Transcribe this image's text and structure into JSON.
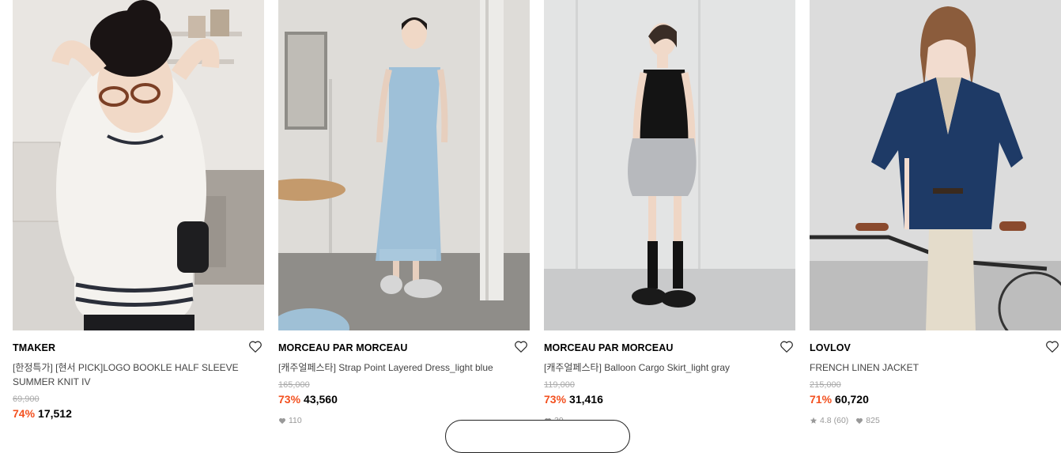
{
  "products": [
    {
      "brand": "TMAKER",
      "title": "[한정특가] [현서 PICK]LOGO BOOKLE HALF SLEEVE SUMMER KNIT IV",
      "original_price": "69,900",
      "discount": "74%",
      "price": "17,512",
      "likes": "",
      "rating": "",
      "reviews": ""
    },
    {
      "brand": "MORCEAU PAR MORCEAU",
      "title": "[캐주얼페스타] Strap Point Layered Dress_light blue",
      "original_price": "165,000",
      "discount": "73%",
      "price": "43,560",
      "likes": "110",
      "rating": "",
      "reviews": ""
    },
    {
      "brand": "MORCEAU PAR MORCEAU",
      "title": "[캐주얼페스타] Balloon Cargo Skirt_light gray",
      "original_price": "119,000",
      "discount": "73%",
      "price": "31,416",
      "likes": "39",
      "rating": "",
      "reviews": ""
    },
    {
      "brand": "LOVLOV",
      "title": "FRENCH LINEN JACKET",
      "original_price": "215,000",
      "discount": "71%",
      "price": "60,720",
      "likes": "825",
      "rating": "4.8",
      "reviews": "(60)"
    }
  ],
  "icons": {
    "wishlist": "heart-outline-icon",
    "like": "heart-filled-icon",
    "rating": "star-icon"
  },
  "colors": {
    "discount": "#f3501f",
    "brand_text": "#000000",
    "title_text": "#444444",
    "muted": "#999999"
  }
}
